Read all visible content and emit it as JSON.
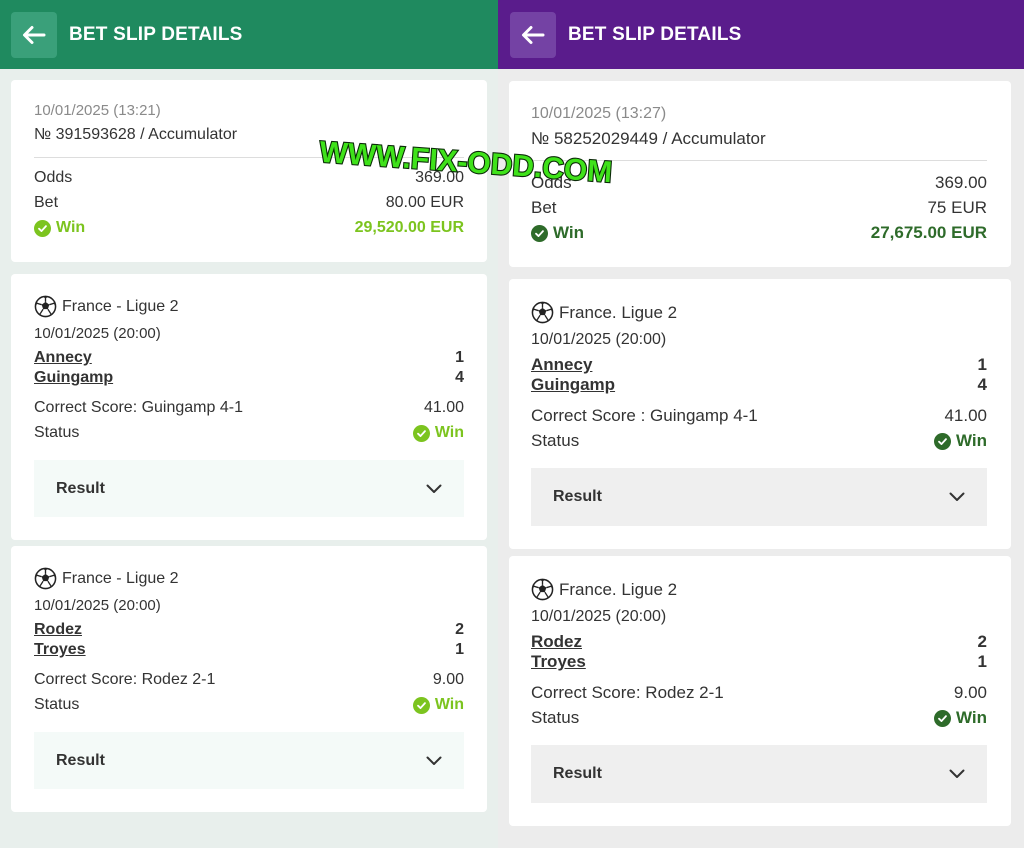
{
  "colors": {
    "left_header": "#1f8a5f",
    "right_header": "#5a1c8c",
    "left_win": "#7cc41f",
    "right_win": "#2e6b2a"
  },
  "left": {
    "header": {
      "title": "BET SLIP DETAILS",
      "back_icon": "arrow-left-icon"
    },
    "summary": {
      "date": "10/01/2025 (13:21)",
      "number": "№ 391593628 / Accumulator",
      "odds_label": "Odds",
      "odds_value": "369.00",
      "bet_label": "Bet",
      "bet_value": "80.00 EUR",
      "win_label": "Win",
      "win_value": "29,520.00 EUR"
    },
    "events": [
      {
        "league": "France - Ligue 2",
        "date": "10/01/2025 (20:00)",
        "home": "Annecy",
        "home_score": "1",
        "away": "Guingamp",
        "away_score": "4",
        "market": "Correct Score: Guingamp 4-1",
        "odds": "41.00",
        "status_label": "Status",
        "status_value": "Win",
        "result_label": "Result"
      },
      {
        "league": "France - Ligue 2",
        "date": "10/01/2025 (20:00)",
        "home": "Rodez",
        "home_score": "2",
        "away": "Troyes",
        "away_score": "1",
        "market": "Correct Score: Rodez 2-1",
        "odds": "9.00",
        "status_label": "Status",
        "status_value": "Win",
        "result_label": "Result"
      }
    ]
  },
  "right": {
    "header": {
      "title": "BET SLIP DETAILS",
      "back_icon": "arrow-left-icon"
    },
    "summary": {
      "date": "10/01/2025 (13:27)",
      "number": "№ 58252029449 / Accumulator",
      "odds_label": "Odds",
      "odds_value": "369.00",
      "bet_label": "Bet",
      "bet_value": "75 EUR",
      "win_label": "Win",
      "win_value": "27,675.00 EUR"
    },
    "events": [
      {
        "league": "France. Ligue 2",
        "date": "10/01/2025 (20:00)",
        "home": "Annecy",
        "home_score": "1",
        "away": "Guingamp",
        "away_score": "4",
        "market": "Correct Score : Guingamp 4-1",
        "odds": "41.00",
        "status_label": "Status",
        "status_value": "Win",
        "result_label": "Result"
      },
      {
        "league": "France. Ligue 2",
        "date": "10/01/2025 (20:00)",
        "home": "Rodez",
        "home_score": "2",
        "away": "Troyes",
        "away_score": "1",
        "market": "Correct Score: Rodez 2-1",
        "odds": "9.00",
        "status_label": "Status",
        "status_value": "Win",
        "result_label": "Result"
      }
    ]
  },
  "watermark": "WWW.FIX-ODD.COM"
}
